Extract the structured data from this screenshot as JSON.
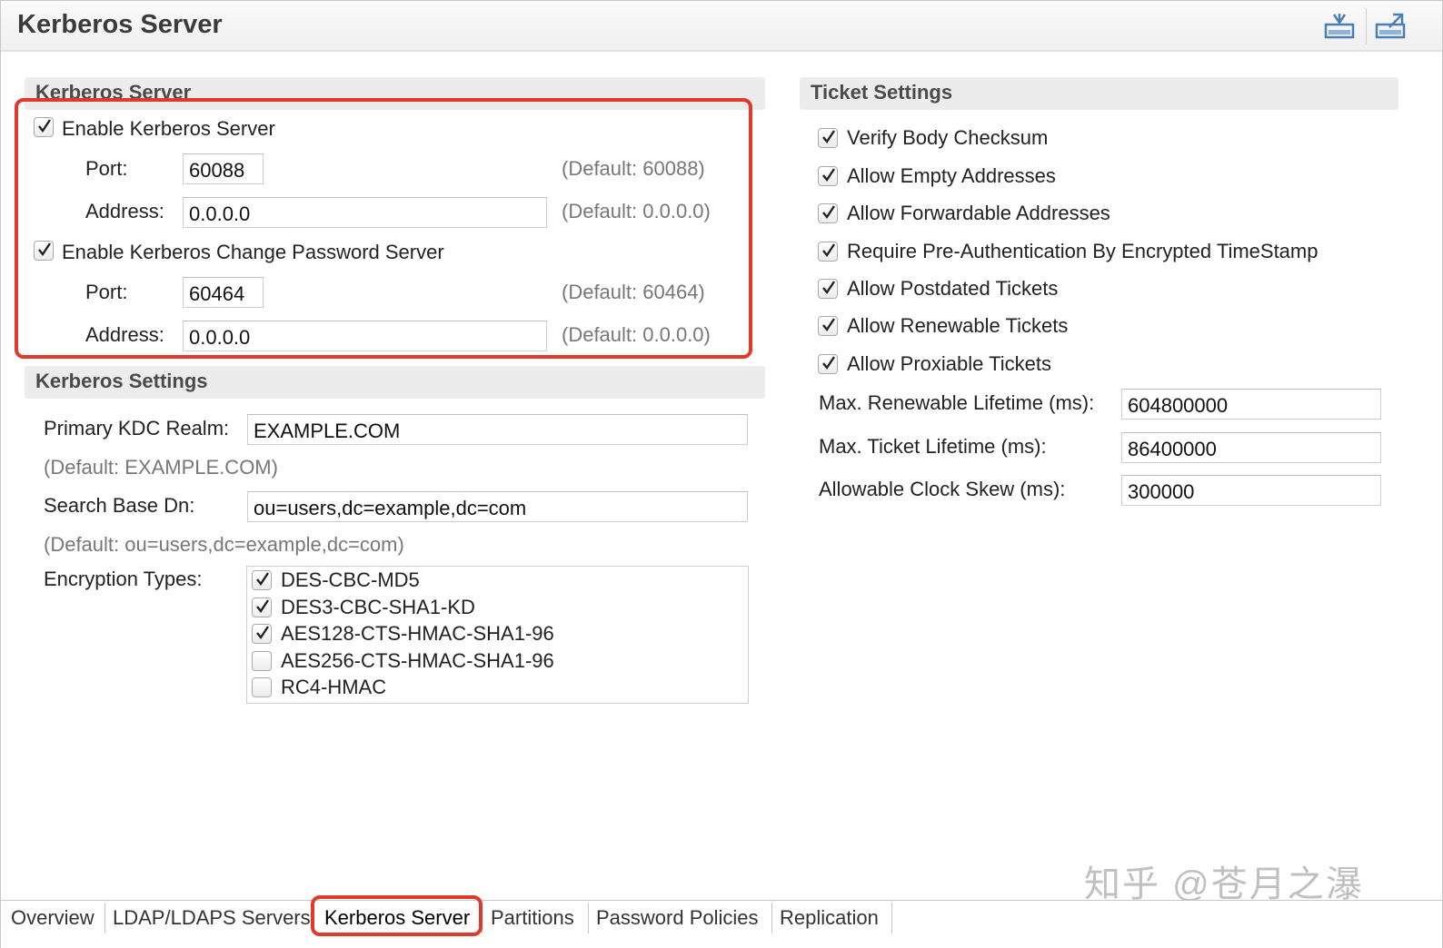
{
  "header": {
    "title": "Kerberos Server",
    "icons": [
      "import-icon",
      "export-icon"
    ]
  },
  "kerberos_server": {
    "section_title": "Kerberos Server",
    "enable_server": {
      "label": "Enable Kerberos Server",
      "checked": true
    },
    "server_port": {
      "label": "Port:",
      "value": "60088",
      "default": "(Default: 60088)"
    },
    "server_address": {
      "label": "Address:",
      "value": "0.0.0.0",
      "default": "(Default: 0.0.0.0)"
    },
    "enable_change_pw": {
      "label": "Enable Kerberos Change Password Server",
      "checked": true
    },
    "change_pw_port": {
      "label": "Port:",
      "value": "60464",
      "default": "(Default: 60464)"
    },
    "change_pw_address": {
      "label": "Address:",
      "value": "0.0.0.0",
      "default": "(Default: 0.0.0.0)"
    }
  },
  "kerberos_settings": {
    "section_title": "Kerberos Settings",
    "realm": {
      "label": "Primary KDC Realm:",
      "value": "EXAMPLE.COM",
      "default": "(Default: EXAMPLE.COM)"
    },
    "search_base": {
      "label": "Search Base Dn:",
      "value": "ou=users,dc=example,dc=com",
      "default": "(Default: ou=users,dc=example,dc=com)"
    },
    "encryption_label": "Encryption Types:",
    "encryption_types": [
      {
        "label": "DES-CBC-MD5",
        "checked": true
      },
      {
        "label": "DES3-CBC-SHA1-KD",
        "checked": true
      },
      {
        "label": "AES128-CTS-HMAC-SHA1-96",
        "checked": true
      },
      {
        "label": "AES256-CTS-HMAC-SHA1-96",
        "checked": false
      },
      {
        "label": "RC4-HMAC",
        "checked": false
      }
    ]
  },
  "ticket_settings": {
    "section_title": "Ticket Settings",
    "options": [
      {
        "label": "Verify Body Checksum",
        "checked": true
      },
      {
        "label": "Allow Empty Addresses",
        "checked": true
      },
      {
        "label": "Allow Forwardable Addresses",
        "checked": true
      },
      {
        "label": "Require Pre-Authentication By Encrypted TimeStamp",
        "checked": true
      },
      {
        "label": "Allow Postdated Tickets",
        "checked": true
      },
      {
        "label": "Allow Renewable Tickets",
        "checked": true
      },
      {
        "label": "Allow Proxiable Tickets",
        "checked": true
      }
    ],
    "max_renewable": {
      "label": "Max. Renewable Lifetime (ms):",
      "value": "604800000"
    },
    "max_ticket": {
      "label": "Max. Ticket Lifetime (ms):",
      "value": "86400000"
    },
    "clock_skew": {
      "label": "Allowable Clock Skew (ms):",
      "value": "300000"
    }
  },
  "tabs": [
    "Overview",
    "LDAP/LDAPS Servers",
    "Kerberos Server",
    "Partitions",
    "Password Policies",
    "Replication"
  ],
  "active_tab": "Kerberos Server",
  "watermark": "知乎 @苍月之瀑",
  "colors": {
    "highlight": "#e03a2a",
    "section_bg": "#ececec"
  }
}
